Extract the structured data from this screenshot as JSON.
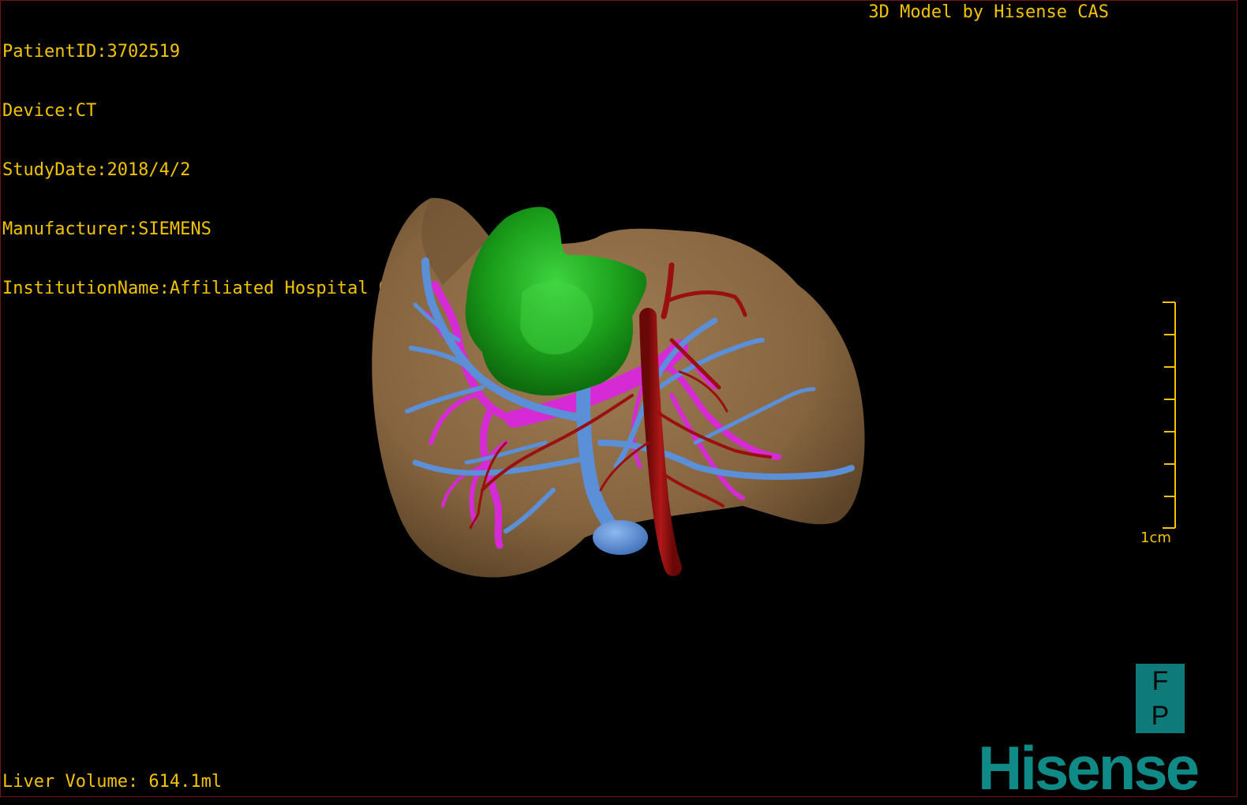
{
  "patient_info": {
    "patient_id": "PatientID:3702519",
    "device": "Device:CT",
    "study_date": "StudyDate:2018/4/2",
    "manufacturer": "Manufacturer:SIEMENS",
    "institution": "InstitutionName:Affiliated Hospital Qingdao University-C"
  },
  "brand_title": "3D Model by Hisense CAS",
  "liver_volume": "Liver Volume: 614.1ml",
  "scale_bar": {
    "label": "1cm"
  },
  "orientation": {
    "top": "F",
    "bottom": "P"
  },
  "logo": "Hisense",
  "colors": {
    "text": "#f2c300",
    "liver": "#8a6a45",
    "tumor": "#1fa51f",
    "hepatic_vein": "#5b8fd8",
    "portal_vein": "#d62ad6",
    "artery": "#9a1010",
    "brand": "#0f8a86"
  }
}
